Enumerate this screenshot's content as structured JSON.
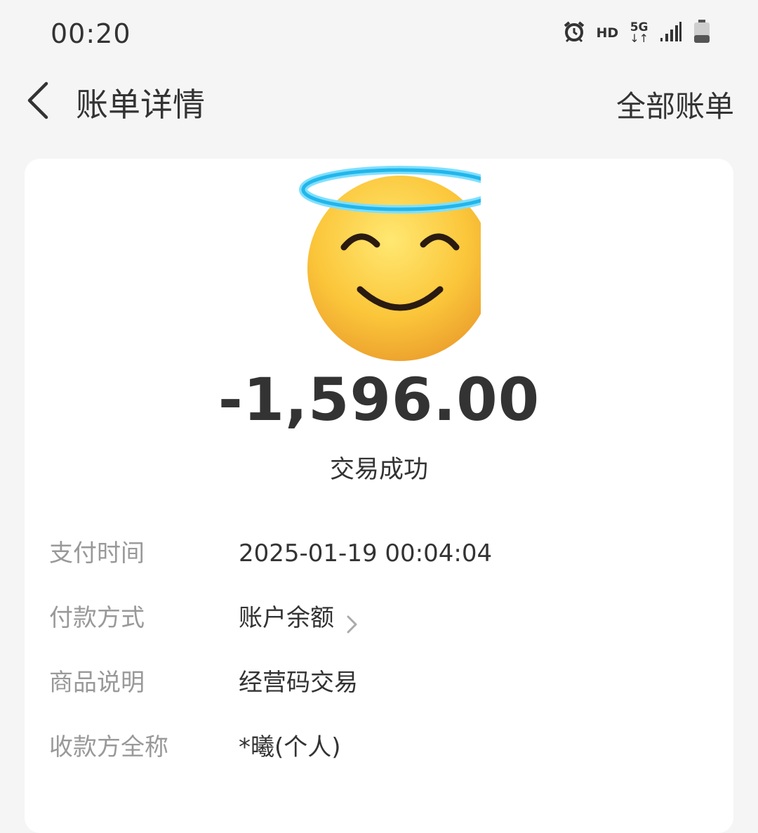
{
  "status_bar": {
    "time": "00:20",
    "icons": [
      "alarm-icon",
      "hd-icon",
      "5g-icon",
      "signal-icon",
      "battery-icon"
    ],
    "hd_label": "HD",
    "network_label": "5G"
  },
  "nav": {
    "back_icon": "chevron-left-icon",
    "title": "账单详情",
    "all_bills_label": "全部账单"
  },
  "bill": {
    "emoji": "smiling-face-with-halo",
    "amount": "-1,596.00",
    "status": "交易成功",
    "details": [
      {
        "label": "支付时间",
        "value": "2025-01-19 00:04:04"
      },
      {
        "label": "付款方式",
        "value": "账户余额"
      },
      {
        "label": "商品说明",
        "value": "经营码交易"
      },
      {
        "label": "收款方全称",
        "value": "*曦(个人)"
      }
    ]
  },
  "colors": {
    "background": "#f5f5f5",
    "card": "#ffffff",
    "primary_text": "#333333",
    "secondary_text": "#999999"
  }
}
